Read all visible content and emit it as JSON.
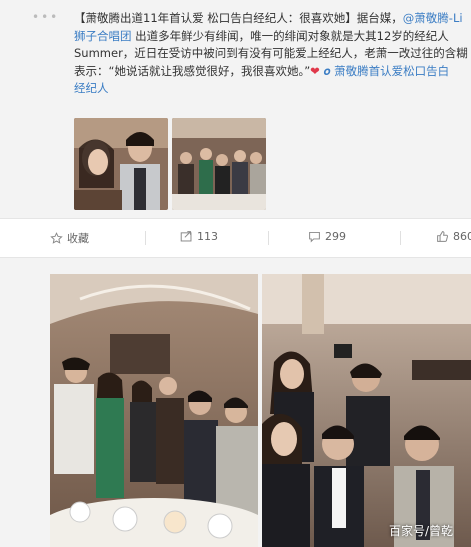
{
  "post": {
    "lines": [
      {
        "pre": "【萧敬腾出道11年首认爱 松口告白经纪人：很喜欢她】据台媒，",
        "link": "@萧敬腾-Li"
      },
      {
        "pre": "",
        "link": "狮子合唱团",
        "post": " 出道多年鲜少有绯闻，唯一的绯闻对象就是大其12岁的经纪人"
      },
      {
        "pre": "Summer，近日在受访中被问到有没有可能爱上经纪人，老萧一改过往的含糊"
      },
      {
        "pre": "表示：“她说话就让我感觉很好，我很喜欢她。”",
        "heart": "❤",
        "link": " 𝒐 萧敬腾首认爱松口告白"
      },
      {
        "pre": "",
        "link": "经纪人"
      }
    ]
  },
  "actions": {
    "favorite": {
      "label": "收藏",
      "icon": "star-icon"
    },
    "forward": {
      "label": "113",
      "icon": "forward-icon"
    },
    "comment": {
      "label": "299",
      "icon": "comment-icon"
    },
    "like": {
      "label": "860",
      "icon": "thumbs-up-icon"
    }
  },
  "watermark": "百家号/曾乾",
  "colors": {
    "link": "#3b7dc4",
    "heart": "#e0384a",
    "background": "#f3f3f3"
  }
}
